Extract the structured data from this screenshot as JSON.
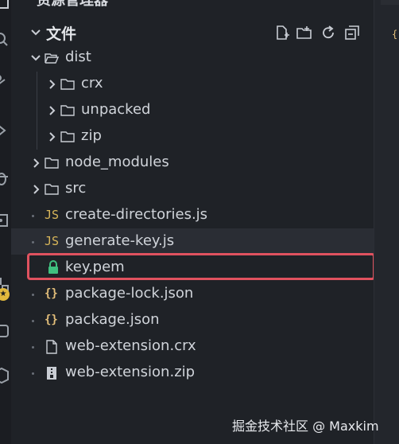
{
  "sidebar": {
    "title": "资源管理器",
    "badge": "★"
  },
  "section": {
    "title": "文件",
    "actions": [
      "new-file-icon",
      "new-folder-icon",
      "refresh-icon",
      "collapse-all-icon"
    ]
  },
  "tree": [
    {
      "label": "dist",
      "type": "folder-open",
      "depth": 0
    },
    {
      "label": "crx",
      "type": "folder",
      "depth": 1
    },
    {
      "label": "unpacked",
      "type": "folder",
      "depth": 1
    },
    {
      "label": "zip",
      "type": "folder",
      "depth": 1
    },
    {
      "label": "node_modules",
      "type": "folder",
      "depth": 0
    },
    {
      "label": "src",
      "type": "folder",
      "depth": 0
    },
    {
      "label": "create-directories.js",
      "type": "js",
      "depth": 0
    },
    {
      "label": "generate-key.js",
      "type": "js",
      "depth": 0
    },
    {
      "label": "key.pem",
      "type": "lock",
      "depth": 0,
      "highlighted": true
    },
    {
      "label": "package-lock.json",
      "type": "json",
      "depth": 0
    },
    {
      "label": "package.json",
      "type": "json",
      "depth": 0
    },
    {
      "label": "web-extension.crx",
      "type": "file",
      "depth": 0
    },
    {
      "label": "web-extension.zip",
      "type": "zip",
      "depth": 0
    }
  ],
  "icons": {
    "js_text": "JS",
    "json_text": "{}"
  },
  "right_panel": {
    "brace": "{"
  },
  "watermark": "掘金技术社区 @ Maxkim",
  "colors": {
    "highlight": "#e0525f",
    "js": "#d8b65a",
    "json": "#e5c07b",
    "lock": "#3fbf7f"
  }
}
